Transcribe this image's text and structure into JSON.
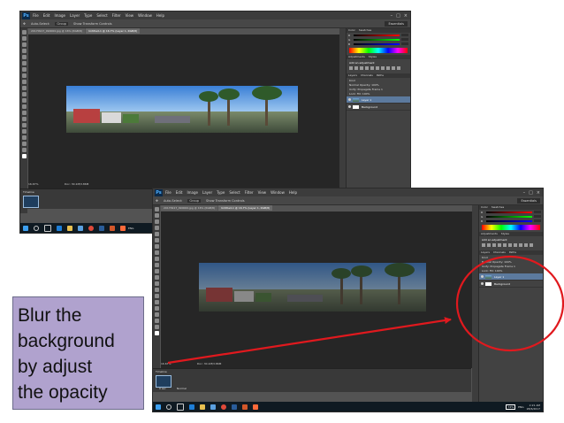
{
  "app": {
    "logo": "Ps",
    "menu": [
      "File",
      "Edit",
      "Image",
      "Layer",
      "Type",
      "Select",
      "Filter",
      "View",
      "Window",
      "Help"
    ],
    "window_controls": [
      "minimize-icon",
      "maximize-icon",
      "close-icon"
    ]
  },
  "options_bar": {
    "auto_select_label": "Auto-Select:",
    "auto_select_value": "Group",
    "show_transform_label": "Show Transform Controls",
    "workspace": "Essentials"
  },
  "documents": {
    "tab_1": "20170917_090000.jpg @ 16% (RGB/8)",
    "tab_2": "Untitled-1 @ 16.7% (Layer 1, RGB/8)",
    "zoom_status": "16.67%",
    "doc_status": "Doc: 30.1M/3.86M"
  },
  "timeline": {
    "title": "Timeline",
    "clip_label": "0 sec",
    "mode": "Normal"
  },
  "panels": {
    "color_tabs": [
      "Color",
      "Swatches"
    ],
    "channels": [
      "R",
      "G",
      "B"
    ],
    "adjustments_tabs": [
      "Adjustments",
      "Styles"
    ],
    "adjustments_title": "Add an adjustment",
    "layer_tabs": [
      "Layers",
      "Channels",
      "Paths"
    ],
    "kind": "Kind",
    "blend_mode": "Normal",
    "opacity_label": "Opacity:",
    "opacity_value": "100%",
    "lock_label": "Lock:",
    "fill_label": "Fill:",
    "fill_value": "100%",
    "unify_label": "Unify:",
    "propagate_label": "Propagate Frame 1",
    "layers": [
      {
        "name": "Layer 1"
      },
      {
        "name": "Background"
      }
    ]
  },
  "taskbar": {
    "clock_time": "2:21 AM",
    "clock_date": "28/6/2017",
    "language": "ENG",
    "battery": "74%"
  },
  "caption": {
    "lines": [
      "Blur the",
      "background",
      "by adjust",
      "the opacity"
    ]
  },
  "colors": {
    "annotation": "#e0191e",
    "caption_bg": "#b0a2ce",
    "ps_bg": "#535353"
  }
}
